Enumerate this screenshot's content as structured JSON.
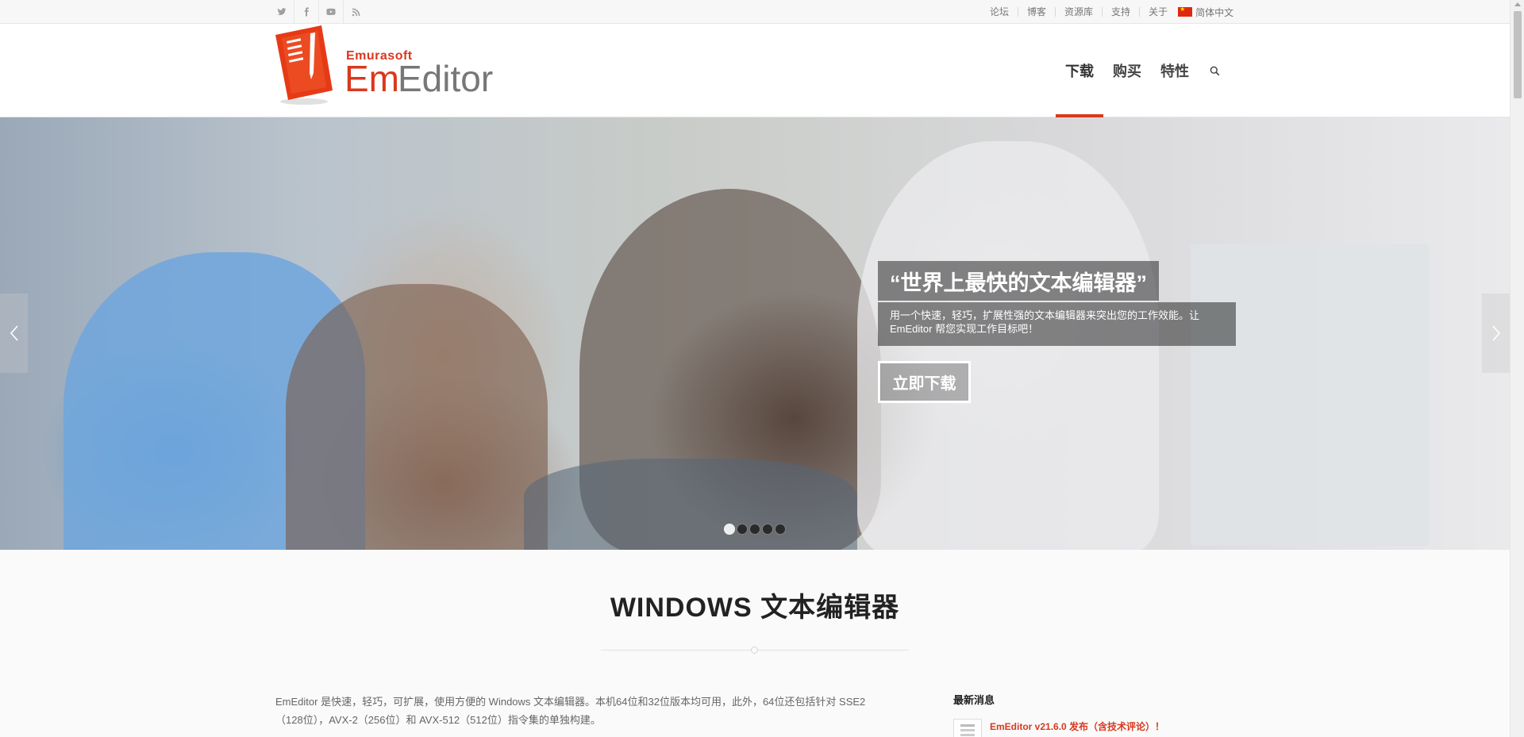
{
  "topbar": {
    "social": [
      {
        "icon": "twitter-icon",
        "name": "twitter-link"
      },
      {
        "icon": "facebook-icon",
        "name": "facebook-link"
      },
      {
        "icon": "youtube-icon",
        "name": "youtube-link"
      },
      {
        "icon": "rss-icon",
        "name": "rss-link"
      }
    ],
    "links": [
      "论坛",
      "博客",
      "资源库",
      "支持",
      "关于"
    ],
    "language": "简体中文"
  },
  "header": {
    "logo_top": "Emurasoft",
    "logo_em": "Em",
    "logo_editor": "Editor",
    "nav": [
      "下载",
      "购买",
      "特性"
    ],
    "active_nav": "下载"
  },
  "hero": {
    "title": "“世界上最快的文本编辑器”",
    "text": "用一个快速，轻巧，扩展性强的文本编辑器来突出您的工作效能。让 EmEditor 帮您实现工作目标吧！",
    "cta": "立即下载",
    "slide_count": 5,
    "active_slide": 1
  },
  "main": {
    "section_title": "WINDOWS 文本编辑器",
    "intro_line1": "EmEditor 是快速，轻巧，可扩展，使用方便的 Windows 文本编辑器。本机64位和32位版本均可用，此外，64位还包括针对 SSE2",
    "intro_line2": "（128位），AVX-2（256位）和 AVX-512（512位）指令集的单独构建。"
  },
  "sidebar": {
    "news_title": "最新消息",
    "news_item": "EmEditor v21.6.0 发布（含技术评论）！"
  },
  "colors": {
    "accent": "#d9381e",
    "text": "#666666",
    "heading": "#222222"
  }
}
